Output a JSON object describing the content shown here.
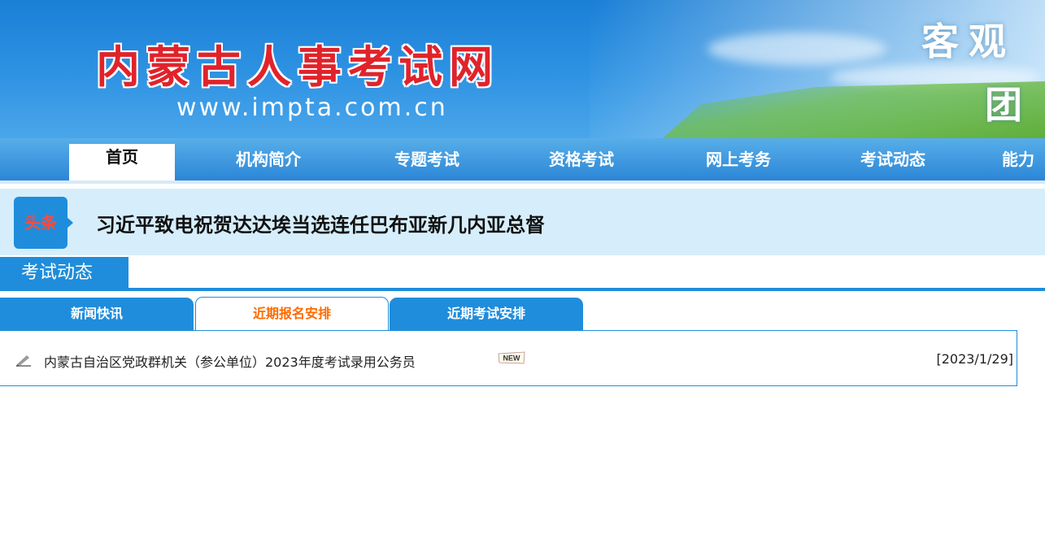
{
  "header": {
    "site_title": "内蒙古人事考试网",
    "site_url": "www.impta.com.cn",
    "slogan_line1": "客观",
    "slogan_line2": "团"
  },
  "nav": {
    "items": [
      {
        "label": "首页"
      },
      {
        "label": "机构简介"
      },
      {
        "label": "专题考试"
      },
      {
        "label": "资格考试"
      },
      {
        "label": "网上考务"
      },
      {
        "label": "考试动态"
      },
      {
        "label": "能力"
      }
    ],
    "active_index": 0
  },
  "headline": {
    "badge": "头条",
    "text": "习近平致电祝贺达达埃当选连任巴布亚新几内亚总督"
  },
  "section": {
    "title": "考试动态",
    "tabs": [
      {
        "label": "新闻快讯"
      },
      {
        "label": "近期报名安排"
      },
      {
        "label": "近期考试安排"
      }
    ],
    "active_tab": 1
  },
  "list": {
    "items": [
      {
        "title": "内蒙古自治区党政群机关（参公单位）2023年度考试录用公务员",
        "badge": "NEW",
        "date": "[2023/1/29]"
      }
    ]
  },
  "colors": {
    "primary_blue": "#1f8ddb",
    "title_red": "#e0232b",
    "active_tab_orange": "#ff6a00",
    "headline_bg": "#d6eefb"
  }
}
